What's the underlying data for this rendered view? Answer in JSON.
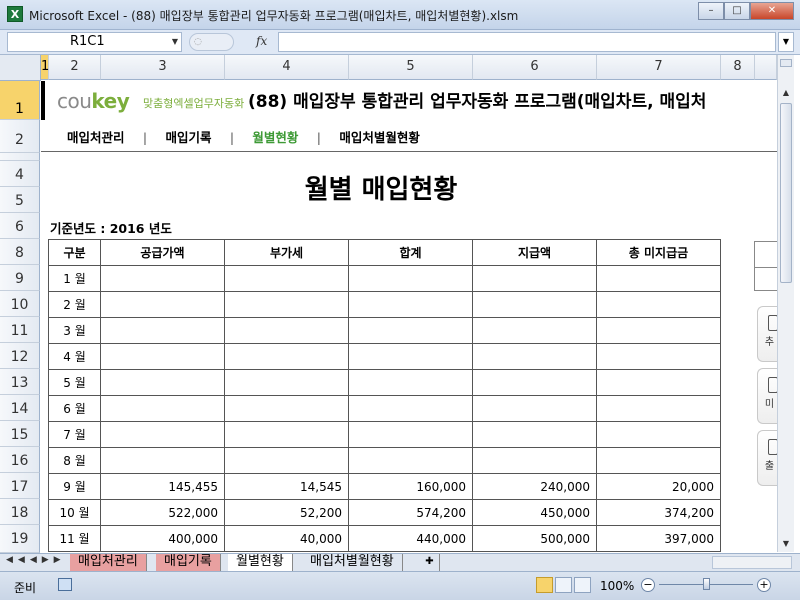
{
  "window": {
    "app_icon": "excel-icon",
    "title": "Microsoft Excel - (88) 매입장부 통합관리 업무자동화 프로그램(매입차트, 매입처별현황).xlsm",
    "buttons": {
      "minimize": "–",
      "maximize": "□",
      "close": "✕"
    }
  },
  "formula_bar": {
    "name_box": "R1C1",
    "fx_label": "fx",
    "formula": ""
  },
  "columns": [
    "1",
    "2",
    "3",
    "4",
    "5",
    "6",
    "7",
    "8"
  ],
  "rows": [
    "1",
    "2",
    "4",
    "5",
    "6",
    "8",
    "9",
    "10",
    "11",
    "12",
    "13",
    "14",
    "15",
    "16",
    "17",
    "18",
    "19"
  ],
  "sheet": {
    "brand_name": "coukey",
    "brand_tagline": "맞춤형엑셀업무자동화",
    "program_title": "(88) 매입장부 통합관리 업무자동화 프로그램(매입차트, 매입처",
    "nav": [
      "매입처관리",
      "매입기록",
      "월별현황",
      "매입처별월현황"
    ],
    "nav_separator": "|",
    "active_nav_index": 2,
    "report_title": "월별 매입현황",
    "basis_year": "기준년도 : 2016 년도",
    "table": {
      "headers": [
        "구분",
        "공급가액",
        "부가세",
        "합계",
        "지급액",
        "총 미지급금"
      ],
      "rows": [
        {
          "month": "1 월",
          "supply": "",
          "vat": "",
          "total": "",
          "paid": "",
          "unpaid": ""
        },
        {
          "month": "2 월",
          "supply": "",
          "vat": "",
          "total": "",
          "paid": "",
          "unpaid": ""
        },
        {
          "month": "3 월",
          "supply": "",
          "vat": "",
          "total": "",
          "paid": "",
          "unpaid": ""
        },
        {
          "month": "4 월",
          "supply": "",
          "vat": "",
          "total": "",
          "paid": "",
          "unpaid": ""
        },
        {
          "month": "5 월",
          "supply": "",
          "vat": "",
          "total": "",
          "paid": "",
          "unpaid": ""
        },
        {
          "month": "6 월",
          "supply": "",
          "vat": "",
          "total": "",
          "paid": "",
          "unpaid": ""
        },
        {
          "month": "7 월",
          "supply": "",
          "vat": "",
          "total": "",
          "paid": "",
          "unpaid": ""
        },
        {
          "month": "8 월",
          "supply": "",
          "vat": "",
          "total": "",
          "paid": "",
          "unpaid": ""
        },
        {
          "month": "9 월",
          "supply": "145,455",
          "vat": "14,545",
          "total": "160,000",
          "paid": "240,000",
          "unpaid": "20,000"
        },
        {
          "month": "10 월",
          "supply": "522,000",
          "vat": "52,200",
          "total": "574,200",
          "paid": "450,000",
          "unpaid": "374,200"
        },
        {
          "month": "11 월",
          "supply": "400,000",
          "vat": "40,000",
          "total": "440,000",
          "paid": "500,000",
          "unpaid": "397,000"
        }
      ]
    },
    "side_buttons": [
      "추",
      "미",
      "출"
    ]
  },
  "sheet_tabs": [
    {
      "label": "매입처관리",
      "style": "red"
    },
    {
      "label": "매입기록",
      "style": "red"
    },
    {
      "label": "월별현황",
      "style": "active"
    },
    {
      "label": "매입처별월현황",
      "style": "normal"
    }
  ],
  "status_bar": {
    "ready": "준비",
    "zoom": "100%",
    "zoom_level_pct": 100
  },
  "colors": {
    "brand_green": "#7cae3c",
    "active_nav": "#3e9a36",
    "red_tab": "#e8a0a0",
    "selected_header": "#f7d36b"
  }
}
